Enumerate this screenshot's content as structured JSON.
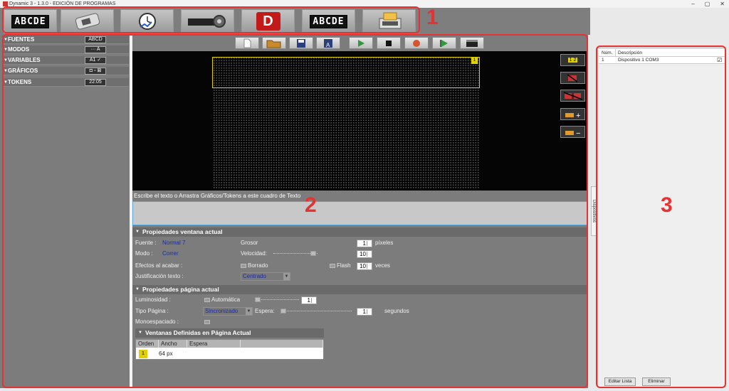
{
  "window": {
    "title": "Dynamic 3 - 1.3.0 - EDICIÓN DE PROGRAMAS",
    "min": "–",
    "max": "▢",
    "close": "✕"
  },
  "annotations": {
    "one": "1",
    "two": "2",
    "three": "3"
  },
  "toolbar_top": {
    "btn1_lcd": "ABCDE",
    "btn7_lcd": "ABCDE",
    "btn5_letter": "D"
  },
  "left_panel": {
    "items": [
      {
        "label": "FUENTES",
        "icon_text": "ABCD"
      },
      {
        "label": "MODOS",
        "icon_text": "··· A"
      },
      {
        "label": "VARIABLES",
        "icon_text": "A1 ✓"
      },
      {
        "label": "GRÁFICOS",
        "icon_text": "◘ ▫ ⊠"
      },
      {
        "label": "TOKENS",
        "icon_text": "22:05"
      }
    ]
  },
  "display": {
    "window_badge": "1"
  },
  "side_buttons": {
    "pages": "1 2"
  },
  "instruction": "Escribe el texto o Arrastra Gráficos/Tokens a este cuadro de Texto",
  "win_props": {
    "title": "Propiedades ventana actual",
    "font_label": "Fuente :",
    "font_value": "Normal 7",
    "mode_label": "Modo :",
    "mode_value": "Correr",
    "effects_label": "Efectos al acabar :",
    "just_label": "Justificación texto :",
    "just_value": "Centrado",
    "grosor_label": "Grosor",
    "grosor_value": "1",
    "grosor_unit": "píxeles",
    "vel_label": "Velocidad:",
    "vel_value": "10",
    "borrado_label": "Borrado",
    "flash_label": "Flash",
    "flash_value": "10",
    "flash_unit": "veces"
  },
  "page_props": {
    "title": "Propiedades página actual",
    "lum_label": "Luminosidad :",
    "auto_label": "Automática",
    "lum_value": "1",
    "tipo_label": "Tipo Página :",
    "tipo_value": "Sincronizado",
    "espera_label": "Espera:",
    "espera_value": "1",
    "espera_unit": "segundos",
    "mono_label": "Monoespaciado :"
  },
  "windows_table": {
    "title": "Ventanas Definidas en Página Actual",
    "columns": [
      "Orden",
      "Ancho",
      "Espera"
    ],
    "rows": [
      {
        "orden": "1",
        "ancho": "64 px",
        "espera": ""
      }
    ]
  },
  "right_panel": {
    "columns": [
      "Núm.",
      "Descripción"
    ],
    "rows": [
      {
        "num": "1",
        "desc": "Dispositivo 1 COM3",
        "checked": "☑"
      }
    ],
    "edit_btn": "Editar Lista",
    "delete_btn": "Eliminar",
    "side_tab": "Dispositivos"
  },
  "colors": {
    "accent_red": "#e53232",
    "link_blue": "#1d2a9c",
    "highlight_yellow": "#e0d000"
  }
}
